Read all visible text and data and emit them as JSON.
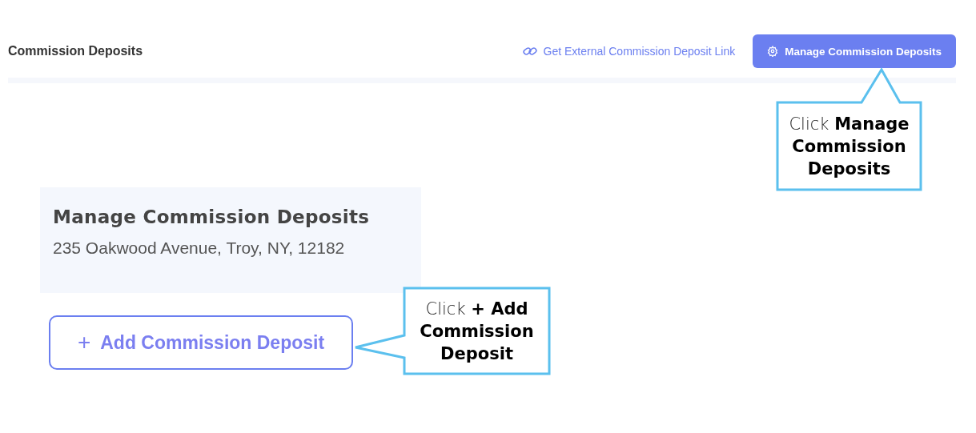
{
  "header": {
    "title": "Commission Deposits",
    "link": "Get External Commission Deposit Link",
    "button": "Manage Commission Deposits"
  },
  "card": {
    "title": "Manage Commission Deposits",
    "address": "235 Oakwood Avenue, Troy, NY, 12182"
  },
  "add_button": {
    "icon": "+",
    "label": "Add Commission Deposit"
  },
  "callouts": [
    {
      "kind": "up",
      "text": "Click **Manage Commission Deposits**"
    },
    {
      "kind": "left",
      "text": "Click **+ Add Commission Deposit**"
    }
  ]
}
